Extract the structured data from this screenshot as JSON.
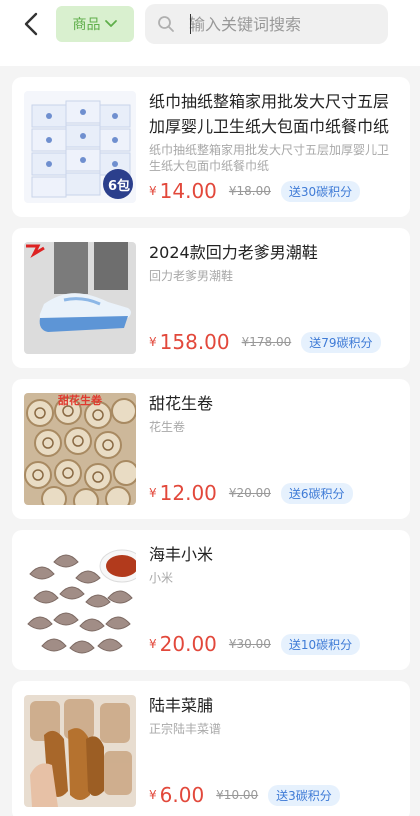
{
  "header": {
    "category_label": "商品",
    "search_placeholder": "输入关键词搜索"
  },
  "products": [
    {
      "title": "纸巾抽纸整箱家用批发大尺寸五层加厚婴儿卫生纸大包面巾纸餐巾纸",
      "subtitle": "纸巾抽纸整箱家用批发大尺寸五层加厚婴儿卫生纸大包面巾纸餐巾纸",
      "price_symbol": "¥",
      "price": "14.00",
      "old_price": "¥18.00",
      "badge": "送30碳积分",
      "image_overlay": "6包",
      "image": "tissue-pack"
    },
    {
      "title": "2024款回力老爹男潮鞋",
      "subtitle": "回力老爹男潮鞋",
      "price_symbol": "¥",
      "price": "158.00",
      "old_price": "¥178.00",
      "badge": "送79碳积分",
      "image": "sneaker"
    },
    {
      "title": "甜花生卷",
      "subtitle": "花生卷",
      "price_symbol": "¥",
      "price": "12.00",
      "old_price": "¥20.00",
      "badge": "送6碳积分",
      "image_overlay": "甜花生卷",
      "image": "peanut-rolls"
    },
    {
      "title": "海丰小米",
      "subtitle": "小米",
      "price_symbol": "¥",
      "price": "20.00",
      "old_price": "¥30.00",
      "badge": "送10碳积分",
      "image": "dumplings"
    },
    {
      "title": "陆丰菜脯",
      "subtitle": "正宗陆丰菜谱",
      "price_symbol": "¥",
      "price": "6.00",
      "old_price": "¥10.00",
      "badge": "送3碳积分",
      "image": "dried-radish"
    }
  ],
  "colors": {
    "accent_price": "#e2483b",
    "badge_bg": "#e6f1fd",
    "badge_text": "#3f7bd6",
    "category_bg": "#d9f0cf",
    "category_text": "#5fae4a"
  }
}
